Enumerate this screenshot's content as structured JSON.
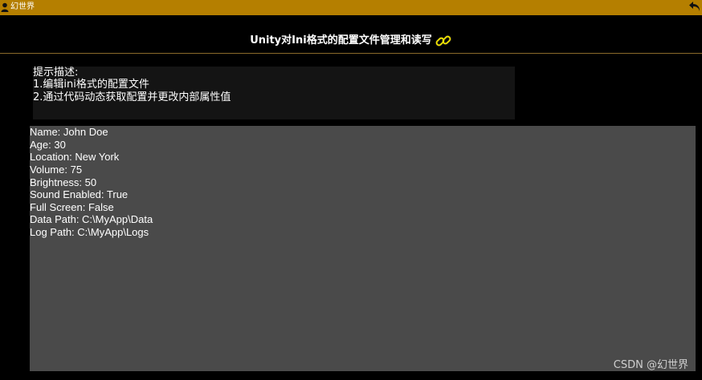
{
  "topbar": {
    "brand": "幻世界",
    "user_icon": "user-icon",
    "back_icon": "undo-arrow-icon",
    "background_color": "#b57f00"
  },
  "header": {
    "title": "Unity对Ini格式的配置文件管理和读写",
    "title_icon": "link-chain-icon",
    "icon_color": "#f5e600"
  },
  "hint": {
    "lines": [
      "提示描述:",
      "1.编辑ini格式的配置文件",
      "2.通过代码动态获取配置并更改内部属性值"
    ]
  },
  "config": {
    "fields": [
      "Name: John Doe",
      "Age: 30",
      "Location: New York",
      "Volume: 75",
      "Brightness: 50",
      "Sound Enabled: True",
      "Full Screen: False",
      "Data Path: C:\\MyApp\\Data",
      "Log Path: C:\\MyApp\\Logs"
    ]
  },
  "watermark": "CSDN @幻世界"
}
